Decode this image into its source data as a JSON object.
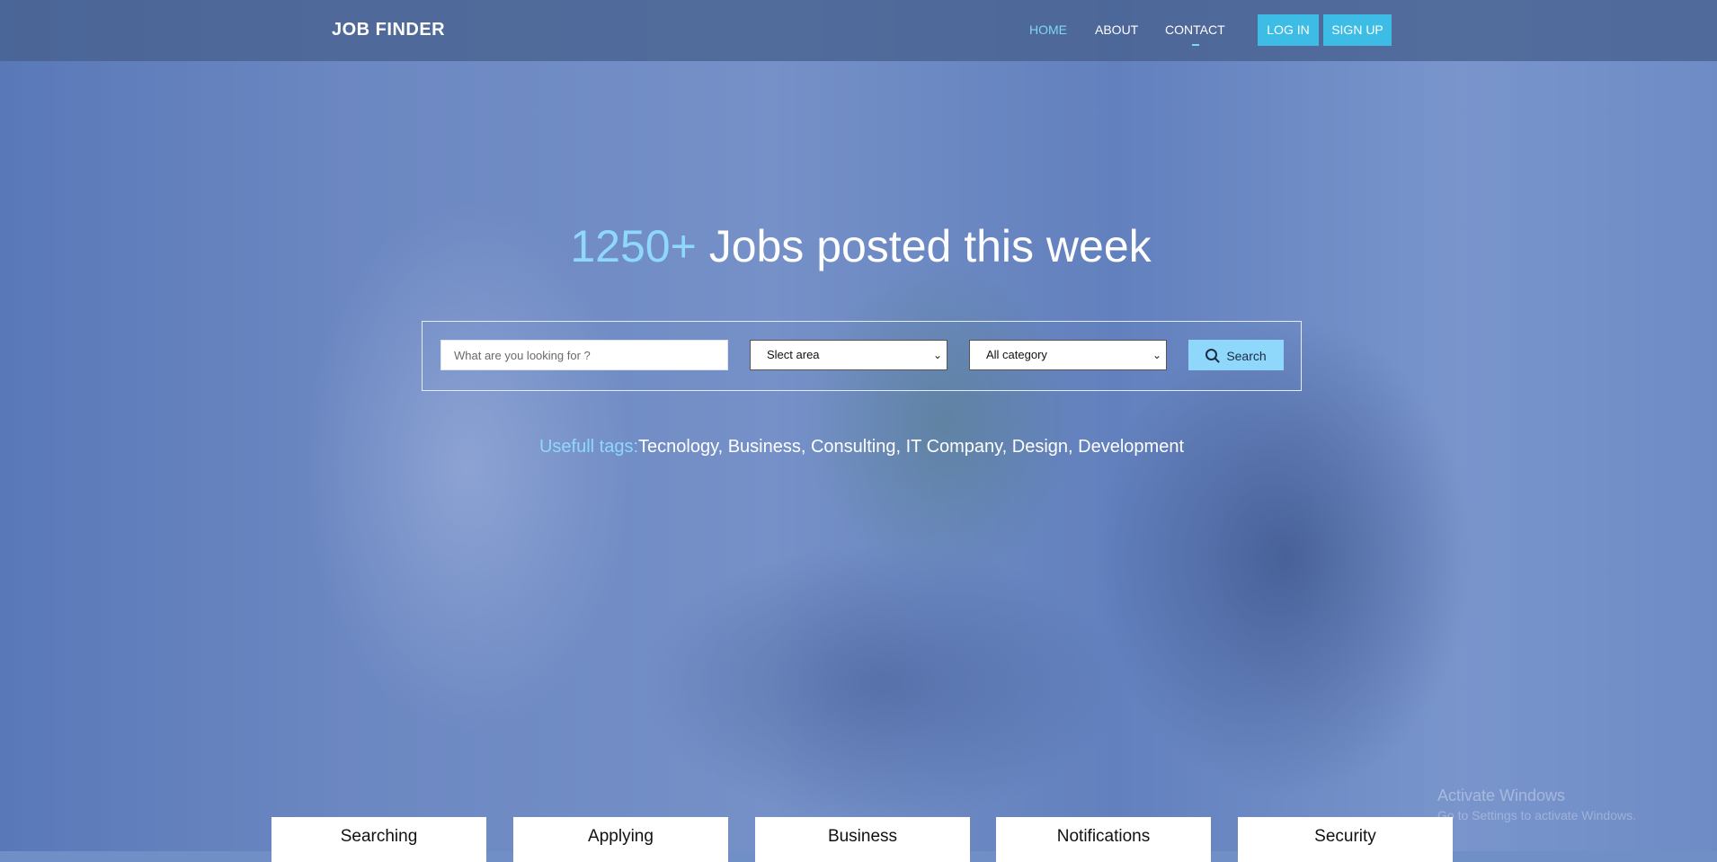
{
  "nav": {
    "brand": "JOB FINDER",
    "links": [
      {
        "label": "HOME",
        "active": true
      },
      {
        "label": "ABOUT",
        "active": false
      },
      {
        "label": "CONTACT",
        "active": false
      }
    ],
    "login_label": "LOG IN",
    "signup_label": "SIGN UP"
  },
  "hero": {
    "count": "1250+",
    "headline_rest": " Jobs posted this week"
  },
  "search": {
    "placeholder": "What are you looking for ?",
    "value": "",
    "area_selected": "Slect area",
    "category_selected": "All category",
    "button_label": "Search"
  },
  "tags": {
    "label": "Usefull tags:",
    "values": "Tecnology, Business, Consulting, IT Company, Design, Development"
  },
  "services": [
    "Searching",
    "Applying",
    "Business",
    "Notifications",
    "Security"
  ],
  "watermark": {
    "title": "Activate Windows",
    "subtitle": "Go to Settings to activate Windows."
  },
  "colors": {
    "accent": "#8fd8fb",
    "button": "#3dbde6",
    "nav_active": "#7fd8f2"
  }
}
